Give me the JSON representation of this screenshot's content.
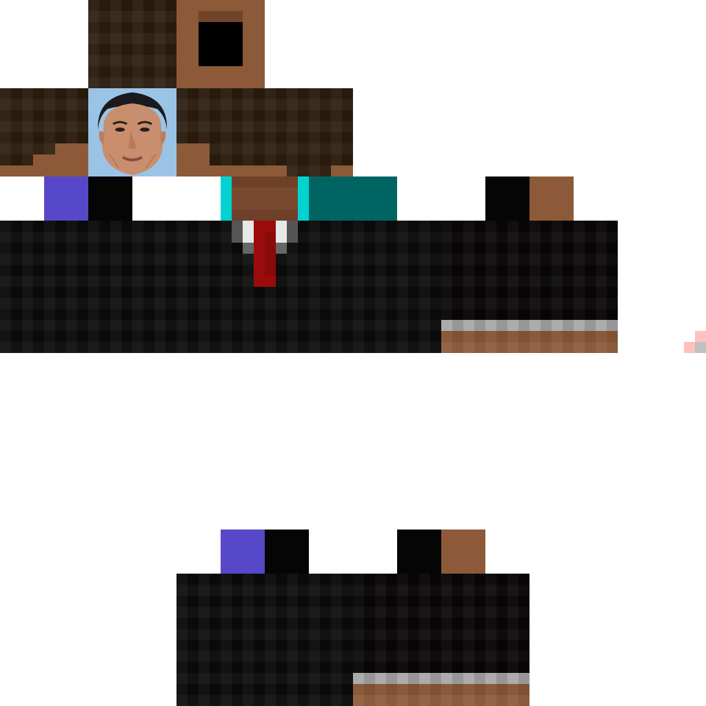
{
  "texture": {
    "kind": "skin-texture-atlas",
    "colors": {
      "hair": "#2c1d0e",
      "skin": "#8c5a38",
      "suit": "#0b0b0b",
      "teal_dark": "#006562",
      "cyan": "#00d3d0",
      "blue_patch": "#5748c9",
      "tie_red": "#9b0b0b",
      "cuff_grey": "#a0a0a0",
      "eye_hole": "#000000",
      "stray_pink": "#ffc0c0"
    },
    "face_image": "photo-portrait"
  }
}
